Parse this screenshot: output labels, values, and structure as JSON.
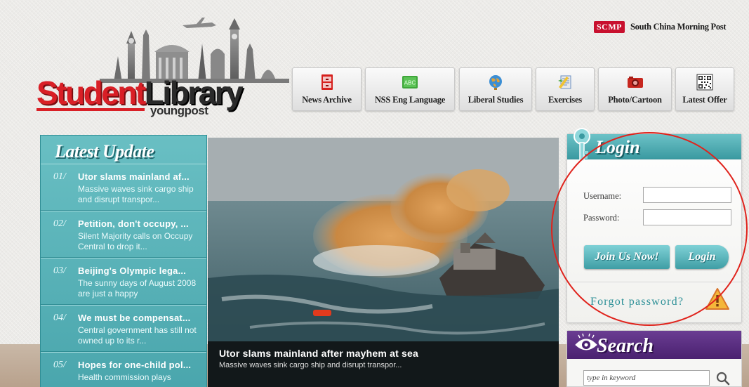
{
  "header": {
    "scmp_badge": "SCMP",
    "scmp_name": "South China Morning Post",
    "logo_student": "Student",
    "logo_library": "Library",
    "logo_sub": "youngpost"
  },
  "nav": [
    {
      "label": "News Archive",
      "icon": "cabinet-icon"
    },
    {
      "label": "NSS Eng Language",
      "icon": "abc-icon"
    },
    {
      "label": "Liberal Studies",
      "icon": "globe-icon"
    },
    {
      "label": "Exercises",
      "icon": "notebook-icon"
    },
    {
      "label": "Photo/Cartoon",
      "icon": "camera-icon"
    },
    {
      "label": "Latest Offer",
      "icon": "qr-code-icon"
    }
  ],
  "latest": {
    "title": "Latest Update",
    "items": [
      {
        "num": "01/",
        "headline": "Utor slams mainland af...",
        "summary": "Massive waves sink cargo ship and disrupt transpor..."
      },
      {
        "num": "02/",
        "headline": "Petition, don't occupy, ...",
        "summary": "Silent Majority calls on Occupy Central to drop it..."
      },
      {
        "num": "03/",
        "headline": "Beijing's Olympic lega...",
        "summary": "The sunny days of August 2008 are just a happy"
      },
      {
        "num": "04/",
        "headline": "We must be compensat...",
        "summary": "Central government has still not owned up to its r..."
      },
      {
        "num": "05/",
        "headline": "Hopes for one-child pol...",
        "summary": "Health commission plays"
      }
    ]
  },
  "feature": {
    "title": "Utor slams mainland after mayhem at sea",
    "subtitle": "Massive waves sink cargo ship and disrupt transpor..."
  },
  "login": {
    "title": "Login",
    "username_label": "Username:",
    "password_label": "Password:",
    "username_value": "",
    "password_value": "",
    "join_button": "Join Us Now!",
    "login_button": "Login",
    "forgot": "Forgot password?"
  },
  "search": {
    "title": "Search",
    "placeholder": "type in keyword"
  },
  "colors": {
    "teal": "#4aa6ad",
    "brand_red": "#d91f26",
    "search_purple": "#4a2170",
    "annotation_red": "#e0231c"
  }
}
